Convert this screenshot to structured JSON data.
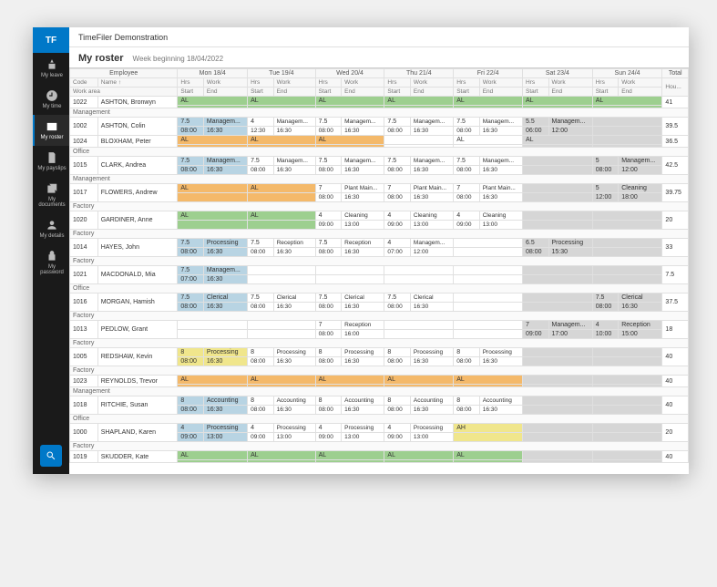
{
  "app_title": "TimeFiler Demonstration",
  "logo": "TF",
  "sidebar": {
    "items": [
      {
        "name": "my-leave",
        "label": "My leave"
      },
      {
        "name": "my-time",
        "label": "My time"
      },
      {
        "name": "my-roster",
        "label": "My roster"
      },
      {
        "name": "my-payslips",
        "label": "My payslips"
      },
      {
        "name": "my-documents",
        "label": "My documents"
      },
      {
        "name": "my-details",
        "label": "My details"
      },
      {
        "name": "my-password",
        "label": "My password"
      }
    ]
  },
  "page": {
    "title": "My roster",
    "week_label": "Week beginning 18/04/2022"
  },
  "head": {
    "employee": "Employee",
    "code": "Code",
    "name": "Name",
    "workarea": "Work area",
    "hrs": "Hrs",
    "work": "Work",
    "start": "Start",
    "end": "End",
    "total": "Total",
    "hou": "Hou...",
    "days": [
      "Mon 18/4",
      "Tue 19/4",
      "Wed 20/4",
      "Thu 21/4",
      "Fri 22/4",
      "Sat 23/4",
      "Sun 24/4"
    ]
  },
  "labels": {
    "AL": "AL",
    "AH": "AH"
  },
  "work_types": {
    "mgmt": "Managem...",
    "reception": "Reception",
    "processing": "Processing",
    "clerical": "Clerical",
    "plant": "Plant Main...",
    "accounting": "Accounting",
    "cleaning": "Cleaning"
  },
  "depts": {
    "management": "Management",
    "office": "Office",
    "factory": "Factory"
  },
  "rows": [
    {
      "code": "1022",
      "name": "ASHTON, Bronwyn",
      "dept": "management",
      "total": "41",
      "days": [
        {
          "cls": "al-green",
          "t": "AL"
        },
        {
          "cls": "al-green",
          "t": "AL"
        },
        {
          "cls": "al-green",
          "t": "AL"
        },
        {
          "cls": "al-green",
          "t": "AL"
        },
        {
          "cls": "al-green",
          "t": "AL"
        },
        {
          "cls": "al-green",
          "t": "AL"
        },
        {
          "cls": "al-green",
          "t": "AL"
        }
      ]
    },
    {
      "code": "1002",
      "name": "ASHTON, Colin",
      "dept": "",
      "total": "39.5",
      "days": [
        {
          "cls": "blue",
          "h": "7.5",
          "w": "mgmt",
          "s": "08:00",
          "e": "16:30"
        },
        {
          "h": "4",
          "w": "mgmt",
          "s": "12:30",
          "e": "16:30"
        },
        {
          "h": "7.5",
          "w": "mgmt",
          "s": "08:00",
          "e": "16:30"
        },
        {
          "h": "7.5",
          "w": "mgmt",
          "s": "08:00",
          "e": "16:30"
        },
        {
          "h": "7.5",
          "w": "mgmt",
          "s": "08:00",
          "e": "16:30"
        },
        {
          "cls": "grey",
          "h": "5.5",
          "w": "mgmt",
          "s": "06:00",
          "e": "12:00"
        },
        {
          "cls": "grey"
        }
      ]
    },
    {
      "code": "1024",
      "name": "BLOXHAM, Peter",
      "dept": "office",
      "total": "36.5",
      "days": [
        {
          "cls": "al-orange",
          "t": "AL"
        },
        {
          "cls": "al-orange",
          "t": "AL"
        },
        {
          "cls": "al-orange",
          "t": "AL"
        },
        {},
        {
          "t": "AL"
        },
        {
          "cls": "grey",
          "t": "AL"
        },
        {
          "cls": "grey"
        }
      ]
    },
    {
      "code": "1015",
      "name": "CLARK, Andrea",
      "dept": "management",
      "total": "42.5",
      "days": [
        {
          "cls": "blue",
          "h": "7.5",
          "w": "mgmt",
          "s": "08:00",
          "e": "16:30"
        },
        {
          "h": "7.5",
          "w": "mgmt",
          "s": "08:00",
          "e": "16:30"
        },
        {
          "h": "7.5",
          "w": "mgmt",
          "s": "08:00",
          "e": "16:30"
        },
        {
          "h": "7.5",
          "w": "mgmt",
          "s": "08:00",
          "e": "16:30"
        },
        {
          "h": "7.5",
          "w": "mgmt",
          "s": "08:00",
          "e": "16:30"
        },
        {
          "cls": "grey"
        },
        {
          "cls": "grey",
          "h": "5",
          "w": "mgmt",
          "s": "08:00",
          "e": "12:00"
        }
      ]
    },
    {
      "code": "1017",
      "name": "FLOWERS, Andrew",
      "dept": "factory",
      "total": "39.75",
      "days": [
        {
          "cls": "al-orange",
          "t": "AL"
        },
        {
          "cls": "al-orange",
          "t": "AL"
        },
        {
          "h": "7",
          "w": "plant",
          "s": "08:00",
          "e": "16:30"
        },
        {
          "h": "7",
          "w": "plant",
          "s": "08:00",
          "e": "16:30"
        },
        {
          "h": "7",
          "w": "plant",
          "s": "08:00",
          "e": "16:30"
        },
        {
          "cls": "grey"
        },
        {
          "cls": "grey",
          "h": "5",
          "w": "cleaning",
          "s": "12:00",
          "e": "18:00"
        }
      ]
    },
    {
      "code": "1020",
      "name": "GARDINER, Anne",
      "dept": "factory",
      "total": "20",
      "days": [
        {
          "cls": "al-green",
          "t": "AL"
        },
        {
          "cls": "al-green",
          "t": "AL"
        },
        {
          "h": "4",
          "w": "cleaning",
          "s": "09:00",
          "e": "13:00"
        },
        {
          "h": "4",
          "w": "cleaning",
          "s": "09:00",
          "e": "13:00"
        },
        {
          "h": "4",
          "w": "cleaning",
          "s": "09:00",
          "e": "13:00"
        },
        {
          "cls": "grey"
        },
        {
          "cls": "grey"
        }
      ]
    },
    {
      "code": "1014",
      "name": "HAYES, John",
      "dept": "factory",
      "total": "33",
      "days": [
        {
          "cls": "blue",
          "h": "7.5",
          "w": "processing",
          "s": "08:00",
          "e": "16:30"
        },
        {
          "h": "7.5",
          "w": "reception",
          "s": "08:00",
          "e": "16:30"
        },
        {
          "h": "7.5",
          "w": "reception",
          "s": "08:00",
          "e": "16:30"
        },
        {
          "h": "4",
          "w": "mgmt",
          "s": "07:00",
          "e": "12:00"
        },
        {},
        {
          "cls": "grey",
          "h": "6.5",
          "w": "processing",
          "s": "08:00",
          "e": "15:30"
        },
        {
          "cls": "grey"
        }
      ]
    },
    {
      "code": "1021",
      "name": "MACDONALD, Mia",
      "dept": "office",
      "total": "7.5",
      "days": [
        {
          "cls": "blue",
          "h": "7.5",
          "w": "mgmt",
          "s": "07:00",
          "e": "16:30"
        },
        {},
        {},
        {},
        {},
        {
          "cls": "grey"
        },
        {
          "cls": "grey"
        }
      ]
    },
    {
      "code": "1016",
      "name": "MORGAN, Hamish",
      "dept": "factory",
      "total": "37.5",
      "days": [
        {
          "cls": "blue",
          "h": "7.5",
          "w": "clerical",
          "s": "08:00",
          "e": "16:30"
        },
        {
          "h": "7.5",
          "w": "clerical",
          "s": "08:00",
          "e": "16:30"
        },
        {
          "h": "7.5",
          "w": "clerical",
          "s": "08:00",
          "e": "16:30"
        },
        {
          "h": "7.5",
          "w": "clerical",
          "s": "08:00",
          "e": "16:30"
        },
        {},
        {
          "cls": "grey"
        },
        {
          "cls": "grey",
          "h": "7.5",
          "w": "clerical",
          "s": "08:00",
          "e": "16:30"
        }
      ]
    },
    {
      "code": "1013",
      "name": "PEDLOW, Grant",
      "dept": "factory",
      "total": "18",
      "days": [
        {},
        {},
        {
          "h": "7",
          "w": "reception",
          "s": "08:00",
          "e": "16:00"
        },
        {},
        {},
        {
          "cls": "grey",
          "h": "7",
          "w": "mgmt",
          "s": "09:00",
          "e": "17:00"
        },
        {
          "cls": "grey",
          "h": "4",
          "w": "reception",
          "s": "10:00",
          "e": "15:00"
        }
      ]
    },
    {
      "code": "1005",
      "name": "REDSHAW, Kevin",
      "dept": "factory",
      "total": "40",
      "days": [
        {
          "cls": "yellow",
          "h": "8",
          "w": "processing",
          "s": "08:00",
          "e": "16:30"
        },
        {
          "h": "8",
          "w": "processing",
          "s": "08:00",
          "e": "16:30"
        },
        {
          "h": "8",
          "w": "processing",
          "s": "08:00",
          "e": "16:30"
        },
        {
          "h": "8",
          "w": "processing",
          "s": "08:00",
          "e": "16:30"
        },
        {
          "h": "8",
          "w": "processing",
          "s": "08:00",
          "e": "16:30"
        },
        {
          "cls": "grey"
        },
        {
          "cls": "grey"
        }
      ]
    },
    {
      "code": "1023",
      "name": "REYNOLDS, Trevor",
      "dept": "management",
      "total": "40",
      "days": [
        {
          "cls": "al-orange",
          "t": "AL"
        },
        {
          "cls": "al-orange",
          "t": "AL"
        },
        {
          "cls": "al-orange",
          "t": "AL"
        },
        {
          "cls": "al-orange",
          "t": "AL"
        },
        {
          "cls": "al-orange",
          "t": "AL"
        },
        {
          "cls": "grey"
        },
        {
          "cls": "grey"
        }
      ]
    },
    {
      "code": "1018",
      "name": "RITCHIE, Susan",
      "dept": "office",
      "total": "40",
      "days": [
        {
          "cls": "blue",
          "h": "8",
          "w": "accounting",
          "s": "08:00",
          "e": "16:30"
        },
        {
          "h": "8",
          "w": "accounting",
          "s": "08:00",
          "e": "16:30"
        },
        {
          "h": "8",
          "w": "accounting",
          "s": "08:00",
          "e": "16:30"
        },
        {
          "h": "8",
          "w": "accounting",
          "s": "08:00",
          "e": "16:30"
        },
        {
          "h": "8",
          "w": "accounting",
          "s": "08:00",
          "e": "16:30"
        },
        {
          "cls": "grey"
        },
        {
          "cls": "grey"
        }
      ]
    },
    {
      "code": "1000",
      "name": "SHAPLAND, Karen",
      "dept": "factory",
      "total": "20",
      "days": [
        {
          "cls": "blue",
          "h": "4",
          "w": "processing",
          "s": "09:00",
          "e": "13:00"
        },
        {
          "h": "4",
          "w": "processing",
          "s": "09:00",
          "e": "13:00"
        },
        {
          "h": "4",
          "w": "processing",
          "s": "09:00",
          "e": "13:00"
        },
        {
          "h": "4",
          "w": "processing",
          "s": "09:00",
          "e": "13:00"
        },
        {
          "cls": "yellow",
          "t": "AH"
        },
        {
          "cls": "grey"
        },
        {
          "cls": "grey"
        }
      ]
    },
    {
      "code": "1019",
      "name": "SKUDDER, Kate",
      "dept": "",
      "total": "40",
      "days": [
        {
          "cls": "al-green",
          "t": "AL"
        },
        {
          "cls": "al-green",
          "t": "AL"
        },
        {
          "cls": "al-green",
          "t": "AL"
        },
        {
          "cls": "al-green",
          "t": "AL"
        },
        {
          "cls": "al-green",
          "t": "AL"
        },
        {
          "cls": "grey"
        },
        {
          "cls": "grey"
        }
      ]
    }
  ]
}
